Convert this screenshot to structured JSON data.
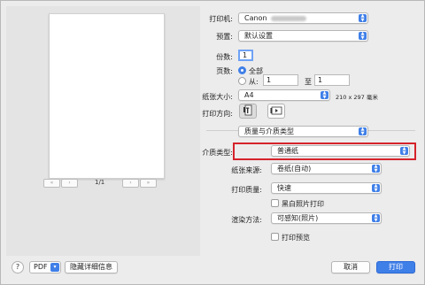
{
  "preview": {
    "page_count": "1/1",
    "first_icon": "«",
    "prev_icon": "‹",
    "next_icon": "›",
    "last_icon": "»"
  },
  "printer": {
    "label": "打印机:",
    "value": "Canon"
  },
  "presets": {
    "label": "预置:",
    "value": "默认设置"
  },
  "copies": {
    "label": "份数:",
    "value": "1"
  },
  "pages": {
    "label": "页数:",
    "all_label": "全部",
    "from_label": "从:",
    "from_value": "1",
    "to_label": "至",
    "to_value": "1"
  },
  "paper_size": {
    "label": "纸张大小:",
    "value": "A4",
    "dimensions": "210 x 297 毫米"
  },
  "orientation": {
    "label": "打印方向:"
  },
  "section": {
    "value": "质量与介质类型"
  },
  "media_type": {
    "label": "介质类型:",
    "value": "普通纸"
  },
  "paper_source": {
    "label": "纸张来源:",
    "value": "卷纸(自动)"
  },
  "print_quality": {
    "label": "打印质量:",
    "value": "快速"
  },
  "grayscale": {
    "label": "黑白照片打印"
  },
  "rendering": {
    "label": "渲染方法:",
    "value": "可感知(照片)"
  },
  "print_preview": {
    "label": "打印预览"
  },
  "footer": {
    "help": "?",
    "pdf": "PDF",
    "hide_details": "隐藏详细信息",
    "cancel": "取消",
    "print": "打印"
  },
  "colors": {
    "accent": "#3f7fe8",
    "highlight": "#d5232b"
  }
}
